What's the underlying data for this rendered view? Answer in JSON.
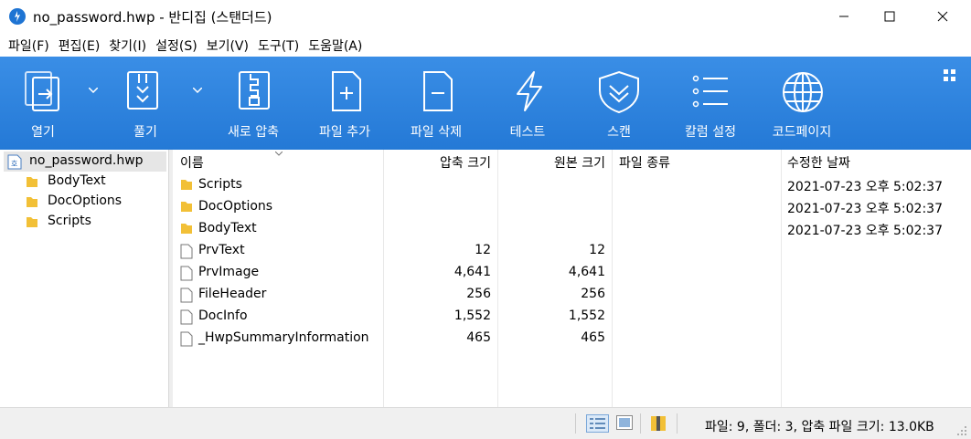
{
  "window": {
    "title": "no_password.hwp - 반디집 (스탠더드)"
  },
  "menu": [
    "파일(F)",
    "편집(E)",
    "찾기(I)",
    "설정(S)",
    "보기(V)",
    "도구(T)",
    "도움말(A)"
  ],
  "toolbar": {
    "open": "열기",
    "extract": "풀기",
    "new_archive": "새로 압축",
    "add_file": "파일 추가",
    "delete_file": "파일 삭제",
    "test": "테스트",
    "scan": "스캔",
    "column_settings": "칼럼 설정",
    "codepage": "코드페이지"
  },
  "tree": {
    "root": "no_password.hwp",
    "items": [
      "BodyText",
      "DocOptions",
      "Scripts"
    ]
  },
  "columns": {
    "name": "이름",
    "compressed": "압축 크기",
    "original": "원본 크기",
    "type": "파일 종류",
    "modified": "수정한 날짜"
  },
  "files": [
    {
      "name": "Scripts",
      "kind": "folder",
      "compressed": "",
      "original": "",
      "modified": "2021-07-23 오후 5:02:37"
    },
    {
      "name": "DocOptions",
      "kind": "folder",
      "compressed": "",
      "original": "",
      "modified": "2021-07-23 오후 5:02:37"
    },
    {
      "name": "BodyText",
      "kind": "folder",
      "compressed": "",
      "original": "",
      "modified": "2021-07-23 오후 5:02:37"
    },
    {
      "name": "PrvText",
      "kind": "file",
      "compressed": "12",
      "original": "12",
      "modified": ""
    },
    {
      "name": "PrvImage",
      "kind": "file",
      "compressed": "4,641",
      "original": "4,641",
      "modified": ""
    },
    {
      "name": "FileHeader",
      "kind": "file",
      "compressed": "256",
      "original": "256",
      "modified": ""
    },
    {
      "name": "DocInfo",
      "kind": "file",
      "compressed": "1,552",
      "original": "1,552",
      "modified": ""
    },
    {
      "name": "_HwpSummaryInformation",
      "kind": "file",
      "compressed": "465",
      "original": "465",
      "modified": ""
    }
  ],
  "status": {
    "text": "파일: 9, 폴더: 3, 압축 파일 크기: 13.0KB"
  },
  "colors": {
    "toolbar": "#2a7fdb",
    "folder": "#f2c037"
  }
}
